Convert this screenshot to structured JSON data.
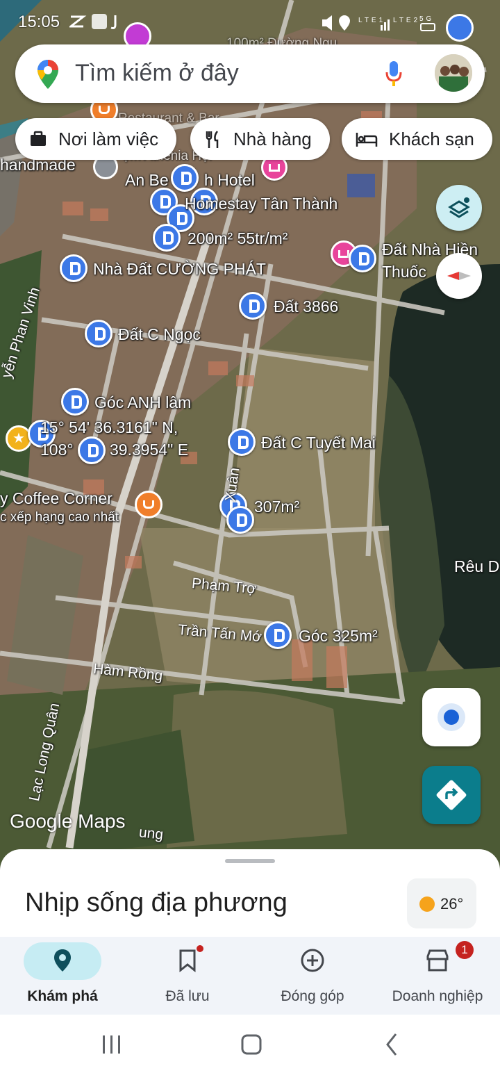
{
  "status_bar": {
    "time": "15:05",
    "network_label_1": "LTE1",
    "network_label_2": "LTE2",
    "network_type": "5G"
  },
  "search": {
    "placeholder": "Tìm kiếm ở đây"
  },
  "chips": [
    {
      "label": "Nơi làm việc",
      "icon": "briefcase-icon"
    },
    {
      "label": "Nhà hàng",
      "icon": "restaurant-icon"
    },
    {
      "label": "Khách sạn",
      "icon": "hotel-icon"
    }
  ],
  "map": {
    "labels": [
      "handmade",
      "An Be",
      "h Hotel",
      "Homestay Tân Thành",
      "200m² 55tr/m²",
      "Đất Nhà Hiền",
      "Thuốc",
      "Nhà Đất CƯỜNG PHÁT",
      "Đất 3866",
      "Đất C Ngọc",
      "Góc ANH lâm",
      "15° 54' 36.3161\" N,",
      "108°",
      "39.3954\" E",
      "Đất C Tuyết Mai",
      "y Coffee Corner",
      "c xếp hạng cao nhất",
      "307m²",
      "Góc 325m²",
      "Rêu D"
    ],
    "streets": [
      "yễn Phan Vinh",
      "Phạm Trợ",
      "Trần Tấn Mớ",
      "Hàm Rồng",
      "Lạc Long Quân",
      "Xuân",
      "ung"
    ],
    "watermark": "Google Maps",
    "overlay_text_top": "100m² Đường Ngu",
    "overlay_text_2": "Restaurant & Bar",
    "overlay_text_3": "ẹm Athenia Hội"
  },
  "sheet": {
    "title": "Nhịp sống địa phương",
    "weather_temp": "26°"
  },
  "bottom_nav": [
    {
      "label": "Khám phá",
      "active": true
    },
    {
      "label": "Đã lưu",
      "dot": true
    },
    {
      "label": "Đóng góp"
    },
    {
      "label": "Doanh nghiệp",
      "badge": "1"
    }
  ],
  "colors": {
    "pin_blue": "#3c78e6",
    "accent_teal": "#0b7d8c",
    "active_pill": "#c6ecf3"
  }
}
